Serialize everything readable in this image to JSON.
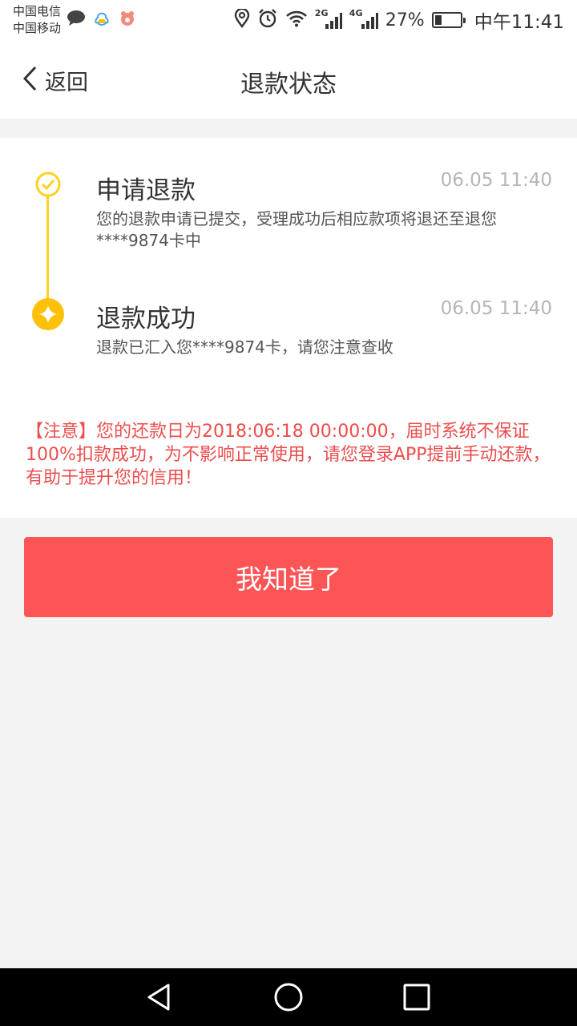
{
  "status_bar": {
    "carrier_1": "中国电信",
    "carrier_2": "中国移动",
    "network_2g": "2G",
    "network_4g": "4G",
    "battery_percent": "27%",
    "battery_level": 0.27,
    "clock": "中午11:41"
  },
  "nav": {
    "back_label": "返回",
    "title": "退款状态"
  },
  "timeline": {
    "steps": [
      {
        "title": "申请退款",
        "time": "06.05 11:40",
        "desc": "您的退款申请已提交，受理成功后相应款项将退还至退您****9874卡中"
      },
      {
        "title": "退款成功",
        "time": "06.05 11:40",
        "desc": "退款已汇入您****9874卡，请您注意查收"
      }
    ]
  },
  "notice": "【注意】您的还款日为2018:06:18 00:00:00，届时系统不保证100%扣款成功，为不影响正常使用，请您登录APP提前手动还款，有助于提升您的信用！",
  "confirm_button": "我知道了",
  "colors": {
    "accent_yellow": "#ffc107",
    "timeline_line": "#ffd21f",
    "button": "#fd5556",
    "notice_text": "#ec4d4d"
  },
  "icons": {
    "back": "chevron-left-icon",
    "step_done": "check-circle-icon",
    "step_current": "sparkle-circle-icon",
    "sys_back": "triangle-back-icon",
    "sys_home": "circle-home-icon",
    "sys_recent": "square-recent-icon"
  }
}
